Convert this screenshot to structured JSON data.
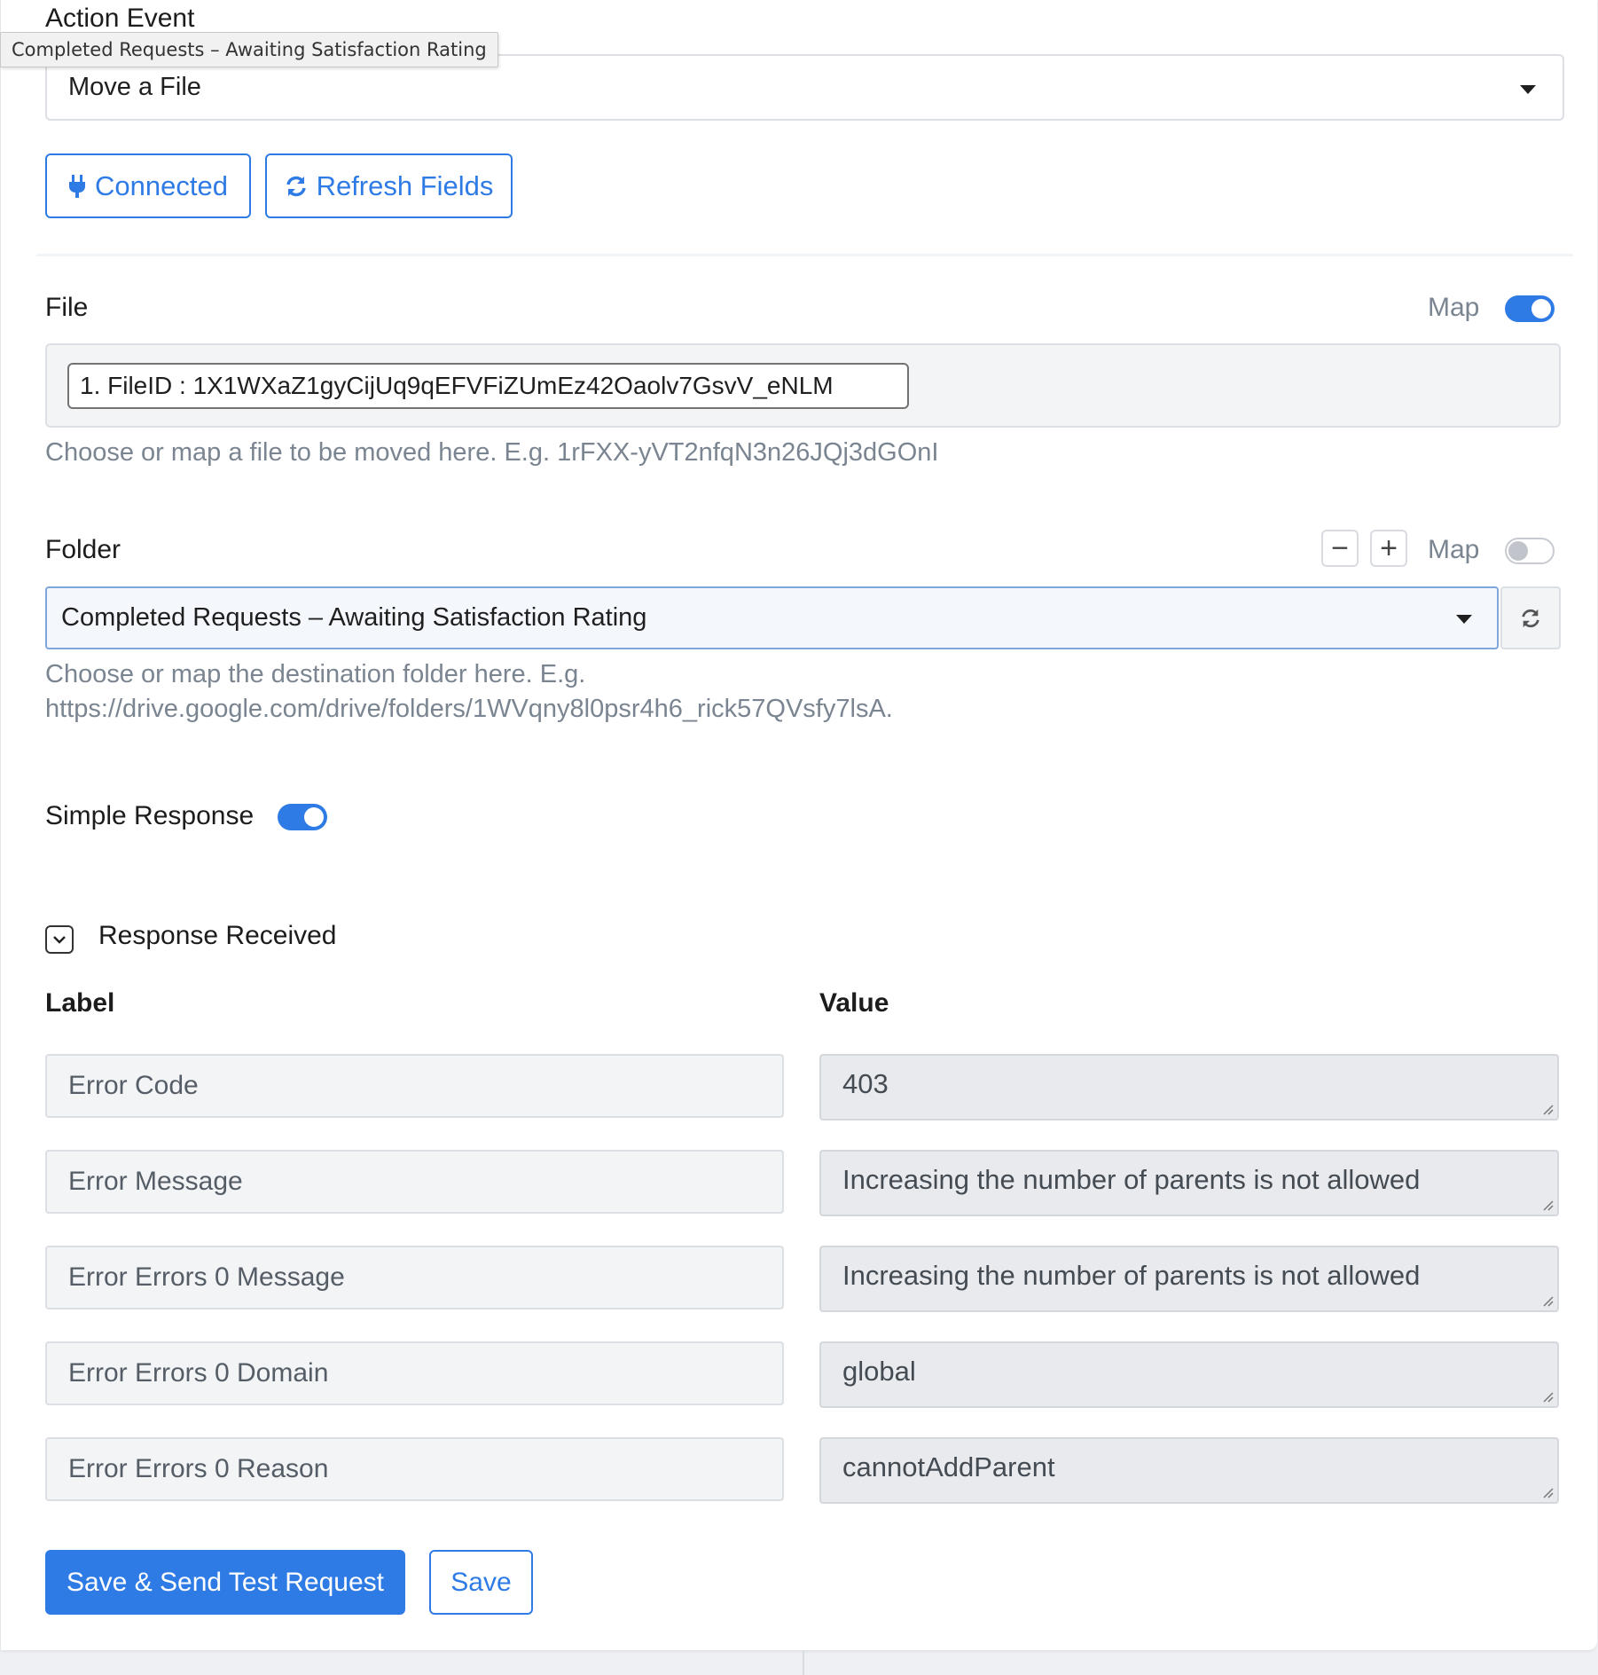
{
  "tooltip": {
    "text": "Completed Requests – Awaiting Satisfaction Rating"
  },
  "action_event": {
    "label": "Action Event",
    "selected": "Move a File"
  },
  "buttons": {
    "connected": "Connected",
    "refresh_fields": "Refresh Fields",
    "save_send": "Save & Send Test Request",
    "save": "Save"
  },
  "file": {
    "label": "File",
    "map_label": "Map",
    "map_on": true,
    "chip": "1. FileID : 1X1WXaZ1gyCijUq9qEFVFiZUmEz42Oaolv7GsvV_eNLM",
    "help": "Choose or map a file to be moved here. E.g. 1rFXX-yVT2nfqN3n26JQj3dGOnI"
  },
  "folder": {
    "label": "Folder",
    "map_label": "Map",
    "map_on": false,
    "minus": "−",
    "plus": "+",
    "selected": "Completed Requests – Awaiting Satisfaction Rating",
    "help_line1": "Choose or map the destination folder here. E.g.",
    "help_line2": "https://drive.google.com/drive/folders/1WVqny8l0psr4h6_rick57QVsfy7lsA."
  },
  "simple_response": {
    "label": "Simple Response",
    "on": true
  },
  "response": {
    "title": "Response Received",
    "label_header": "Label",
    "value_header": "Value",
    "rows": [
      {
        "label": "Error Code",
        "value": "403"
      },
      {
        "label": "Error Message",
        "value": "Increasing the number of parents is not allowed"
      },
      {
        "label": "Error Errors 0 Message",
        "value": "Increasing the number of parents is not allowed"
      },
      {
        "label": "Error Errors 0 Domain",
        "value": "global"
      },
      {
        "label": "Error Errors 0 Reason",
        "value": "cannotAddParent"
      }
    ]
  },
  "colors": {
    "accent": "#2f7be5",
    "help_text": "#7a8591"
  },
  "icons": {
    "connected": "plug-icon",
    "refresh_fields": "sync-icon",
    "folder_refresh": "refresh-icon",
    "dropdown": "caret-down-icon",
    "collapse": "chevron-down-icon",
    "resize": "resize-grip-icon"
  }
}
